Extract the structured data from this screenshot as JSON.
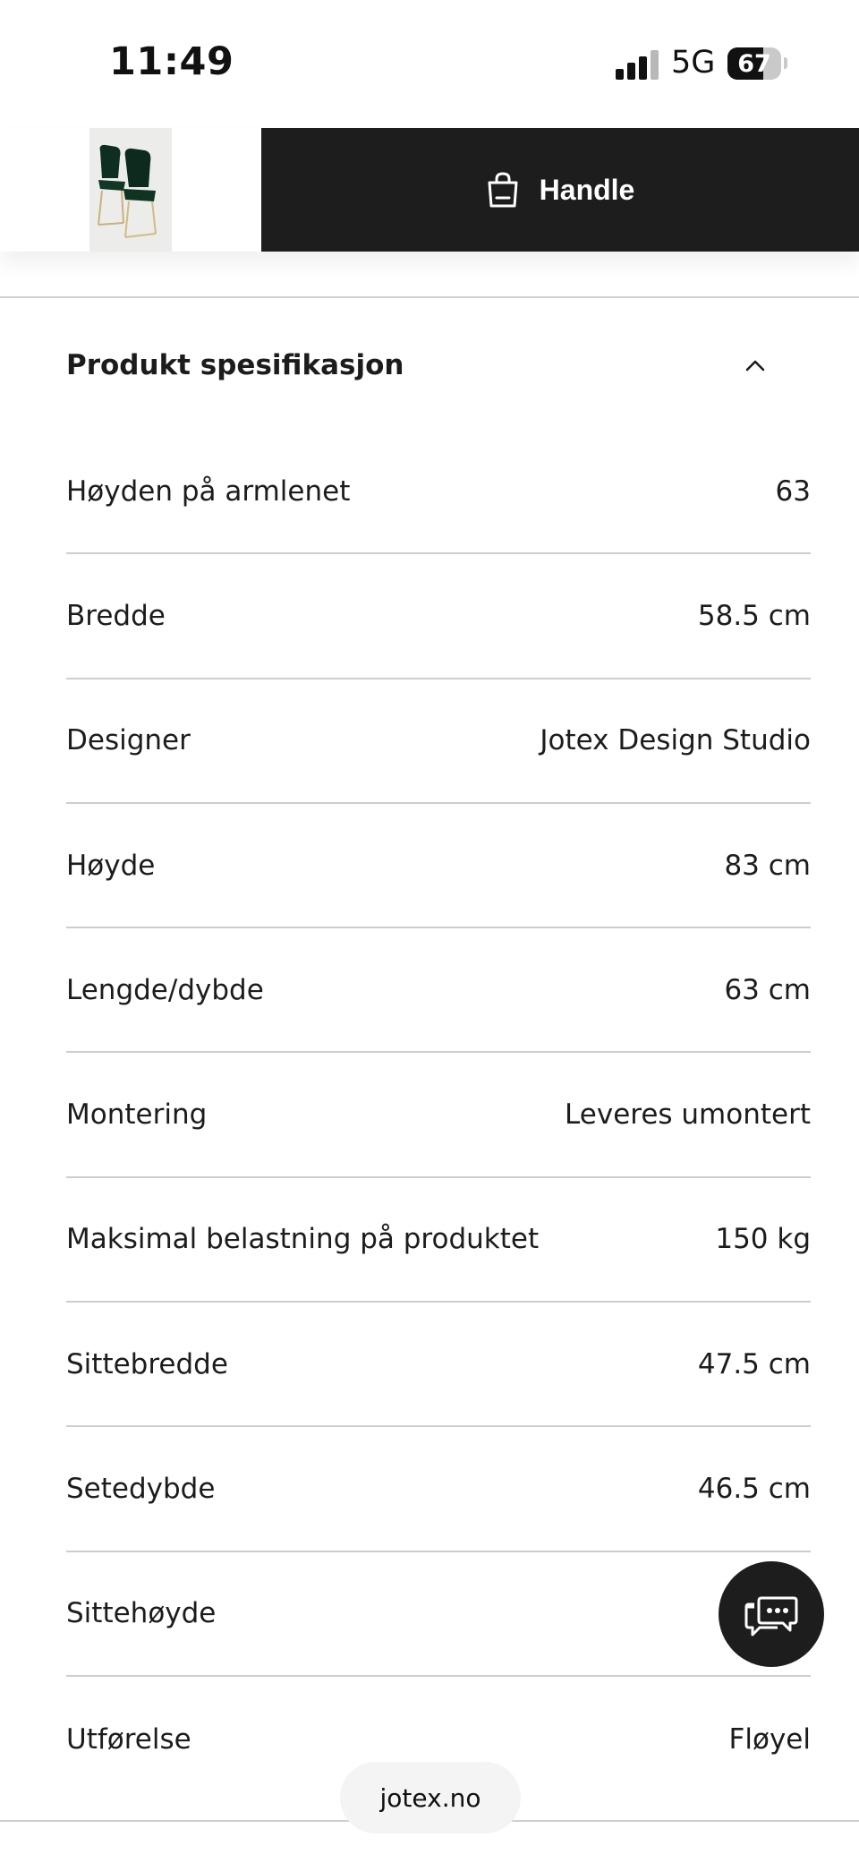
{
  "status_bar": {
    "time": "11:49",
    "network": "5G",
    "battery": "67",
    "battery_level": 0.67
  },
  "buy_bar": {
    "thumbnail_icon": "chair-thumbnail",
    "button_icon": "shopping-bag-icon",
    "button_label": "Handle",
    "button_color": "#1d1d1d"
  },
  "spec_section": {
    "title": "Produkt spesifikasjon",
    "toggle_icon": "chevron-up-icon",
    "rows": [
      {
        "label": "Høyden på armlenet",
        "value": "63"
      },
      {
        "label": "Bredde",
        "value": "58.5 cm"
      },
      {
        "label": "Designer",
        "value": "Jotex Design Studio"
      },
      {
        "label": "Høyde",
        "value": "83 cm"
      },
      {
        "label": "Lengde/dybde",
        "value": "63 cm"
      },
      {
        "label": "Montering",
        "value": "Leveres umontert"
      },
      {
        "label": "Maksimal belastning på produktet",
        "value": "150 kg"
      },
      {
        "label": "Sittebredde",
        "value": "47.5 cm"
      },
      {
        "label": "Setedybde",
        "value": "46.5 cm"
      },
      {
        "label": "Sittehøyde",
        "value": ""
      },
      {
        "label": "Utførelse",
        "value": "Fløyel"
      }
    ]
  },
  "chat": {
    "icon": "chat-bubbles-icon"
  },
  "browser": {
    "url": "jotex.no"
  }
}
